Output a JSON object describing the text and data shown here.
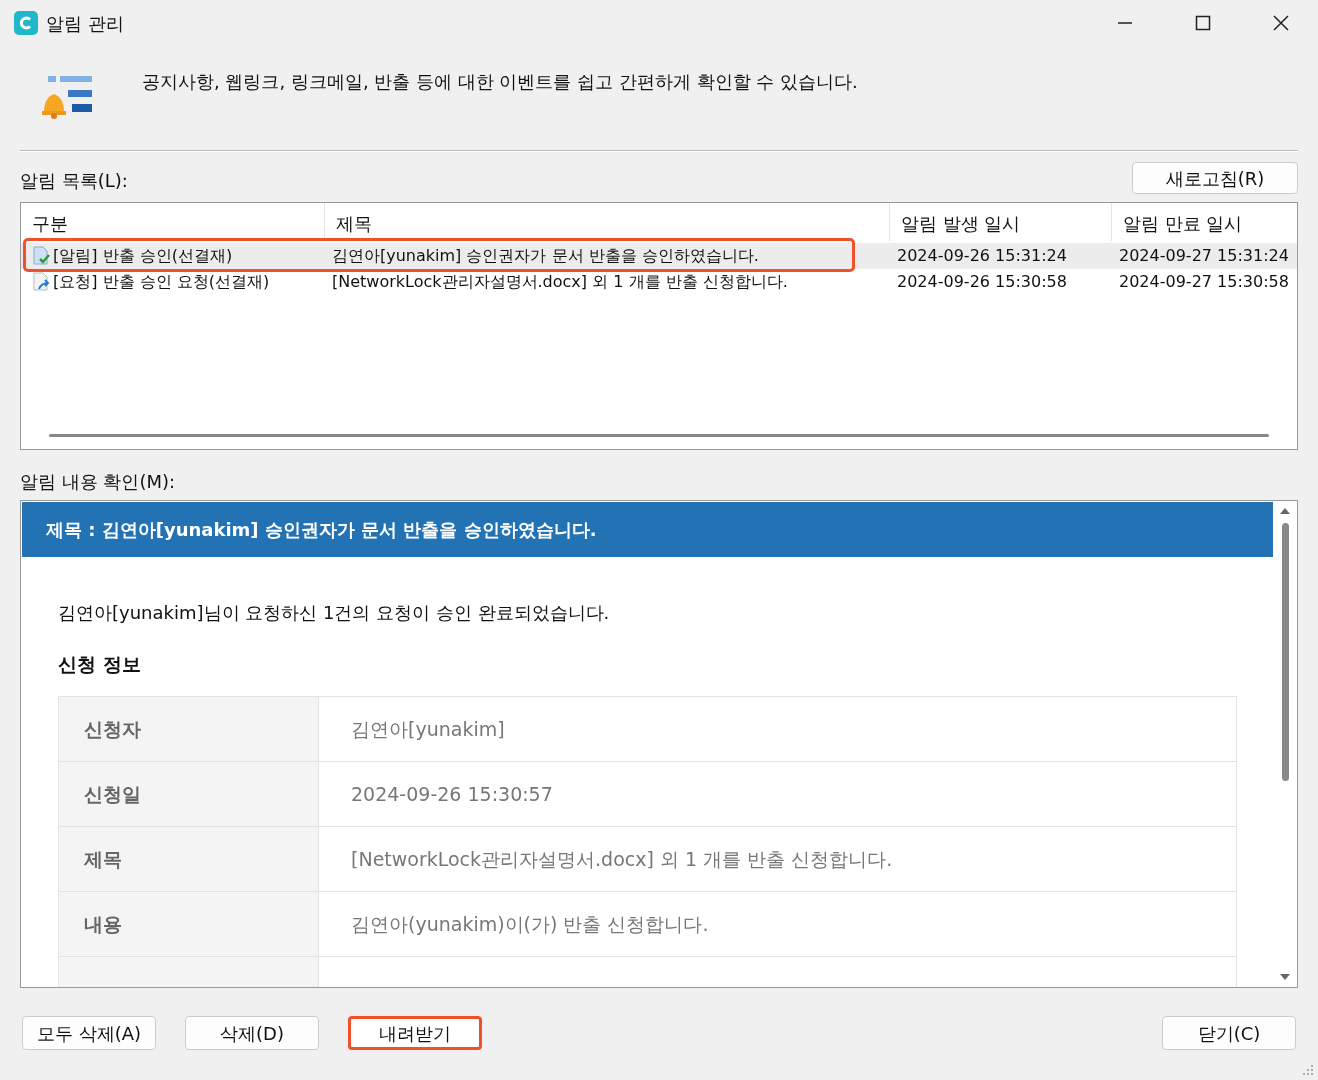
{
  "window": {
    "title": "알림 관리"
  },
  "header": {
    "description": "공지사항, 웹링크, 링크메일, 반출 등에 대한 이벤트를 쉽고 간편하게 확인할 수 있습니다."
  },
  "list": {
    "label": "알림 목록(L):",
    "refresh_button": "새로고침(R)",
    "columns": [
      "구분",
      "제목",
      "알림 발생 일시",
      "알림 만료 일시"
    ],
    "rows": [
      {
        "kind": "approved",
        "category": "[알림] 반출 승인(선결재)",
        "title": "김연아[yunakim] 승인권자가 문서 반출을 승인하였습니다.",
        "issued": "2024-09-26 15:31:24",
        "expires": "2024-09-27 15:31:24",
        "selected": true,
        "highlighted": true
      },
      {
        "kind": "request",
        "category": "[요청] 반출 승인 요청(선결재)",
        "title": "[NetworkLock관리자설명서.docx] 외 1 개를 반출 신청합니다.",
        "issued": "2024-09-26 15:30:58",
        "expires": "2024-09-27 15:30:58",
        "selected": false,
        "highlighted": false
      }
    ]
  },
  "detail": {
    "label": "알림 내용 확인(M):",
    "title": "제목 : 김연아[yunakim] 승인권자가 문서 반출을 승인하였습니다.",
    "message": "김연아[yunakim]님이 요청하신 1건의 요청이 승인 완료되었습니다.",
    "section": "신청 정보",
    "fields": [
      {
        "label": "신청자",
        "value": "김연아[yunakim]"
      },
      {
        "label": "신청일",
        "value": "2024-09-26 15:30:57"
      },
      {
        "label": "제목",
        "value": "[NetworkLock관리자설명서.docx] 외 1 개를 반출 신청합니다."
      },
      {
        "label": "내용",
        "value": "김연아(yunakim)이(가) 반출 신청합니다."
      }
    ]
  },
  "buttons": [
    {
      "label": "모두 삭제(A)",
      "highlighted": false
    },
    {
      "label": "삭제(D)",
      "highlighted": false
    },
    {
      "label": "내려받기",
      "highlighted": true
    },
    {
      "label": "닫기(C)",
      "highlighted": false
    }
  ]
}
